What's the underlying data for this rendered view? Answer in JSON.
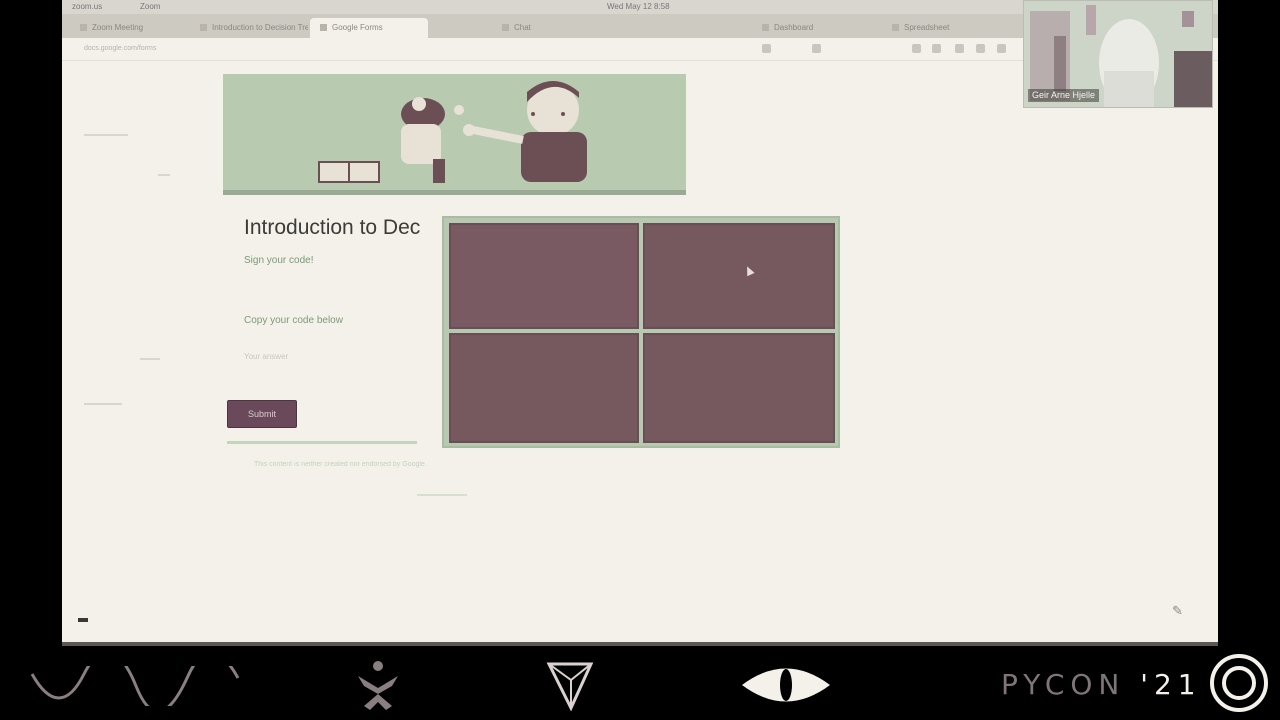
{
  "menubar": {
    "app": "zoom.us",
    "menu": "Zoom",
    "clock": "Wed May 12  8:58"
  },
  "browser": {
    "tabs": [
      {
        "label": "Zoom Meeting"
      },
      {
        "label": "Introduction to Decision Trees"
      },
      {
        "label": "Google Forms"
      },
      {
        "label": "Chat"
      },
      {
        "label": "Dashboard"
      },
      {
        "label": "Spreadsheet"
      }
    ],
    "url": "docs.google.com/forms"
  },
  "form": {
    "title": "Introduction to Dec",
    "subtitle": "Sign your code!",
    "code_label": "Copy your code below",
    "answer_label": "Your answer",
    "submit_label": "Submit",
    "footer_note": "This content is neither created nor endorsed by Google."
  },
  "webcam": {
    "participant_name": "Geir Arne Hjelle"
  },
  "branding": {
    "event_text": "PYCON",
    "year_text": " '21"
  },
  "icons": {
    "wave": "wave-logo-icon",
    "figure": "figure-logo-icon",
    "triangle": "triangle-logo-icon",
    "eye": "eye-logo-icon",
    "ring": "ring-logo-icon",
    "pen": "pen-icon"
  },
  "colors": {
    "page_bg": "#f4f1ea",
    "banner_green": "#b8cbb1",
    "tile_mauve": "#76595f",
    "submit_bg": "#6a4a5a",
    "bottom_bar": "#000000",
    "accent_light": "#f4f0ea"
  }
}
